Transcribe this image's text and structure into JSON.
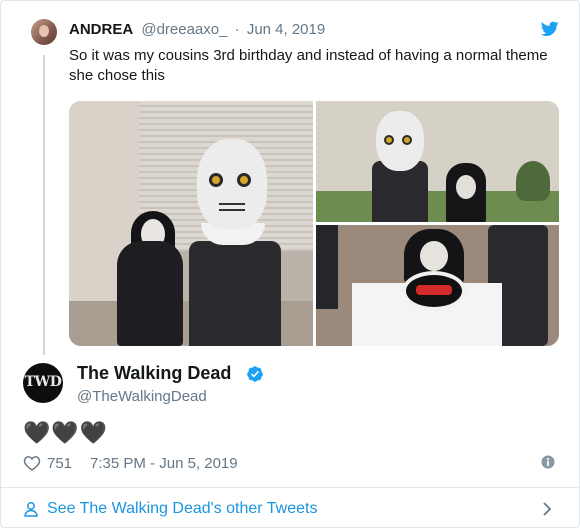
{
  "quoted_tweet": {
    "name": "ANDREA",
    "handle": "@dreeaaxo_",
    "separator": "·",
    "date": "Jun 4, 2019",
    "text": "So it was my cousins 3rd birthday and instead of having a normal theme she chose this"
  },
  "tweet": {
    "name": "The Walking Dead",
    "handle": "@TheWalkingDead",
    "avatar_text": "TWD",
    "text": "🖤🖤🖤",
    "like_count": "751",
    "timestamp": "7:35 PM - Jun 5, 2019"
  },
  "footer": {
    "link_label": "See The Walking Dead's other Tweets"
  },
  "icons": {
    "platform": "bird-icon",
    "verified": "verified-icon",
    "like": "heart-icon",
    "info": "info-icon",
    "profile": "user-icon",
    "next": "chevron-right-icon"
  },
  "colors": {
    "brand_blue": "#1da1f2",
    "link_blue": "#1b95e0",
    "secondary_text": "#657786",
    "primary_text": "#14171a",
    "border": "#e1e8ed"
  }
}
